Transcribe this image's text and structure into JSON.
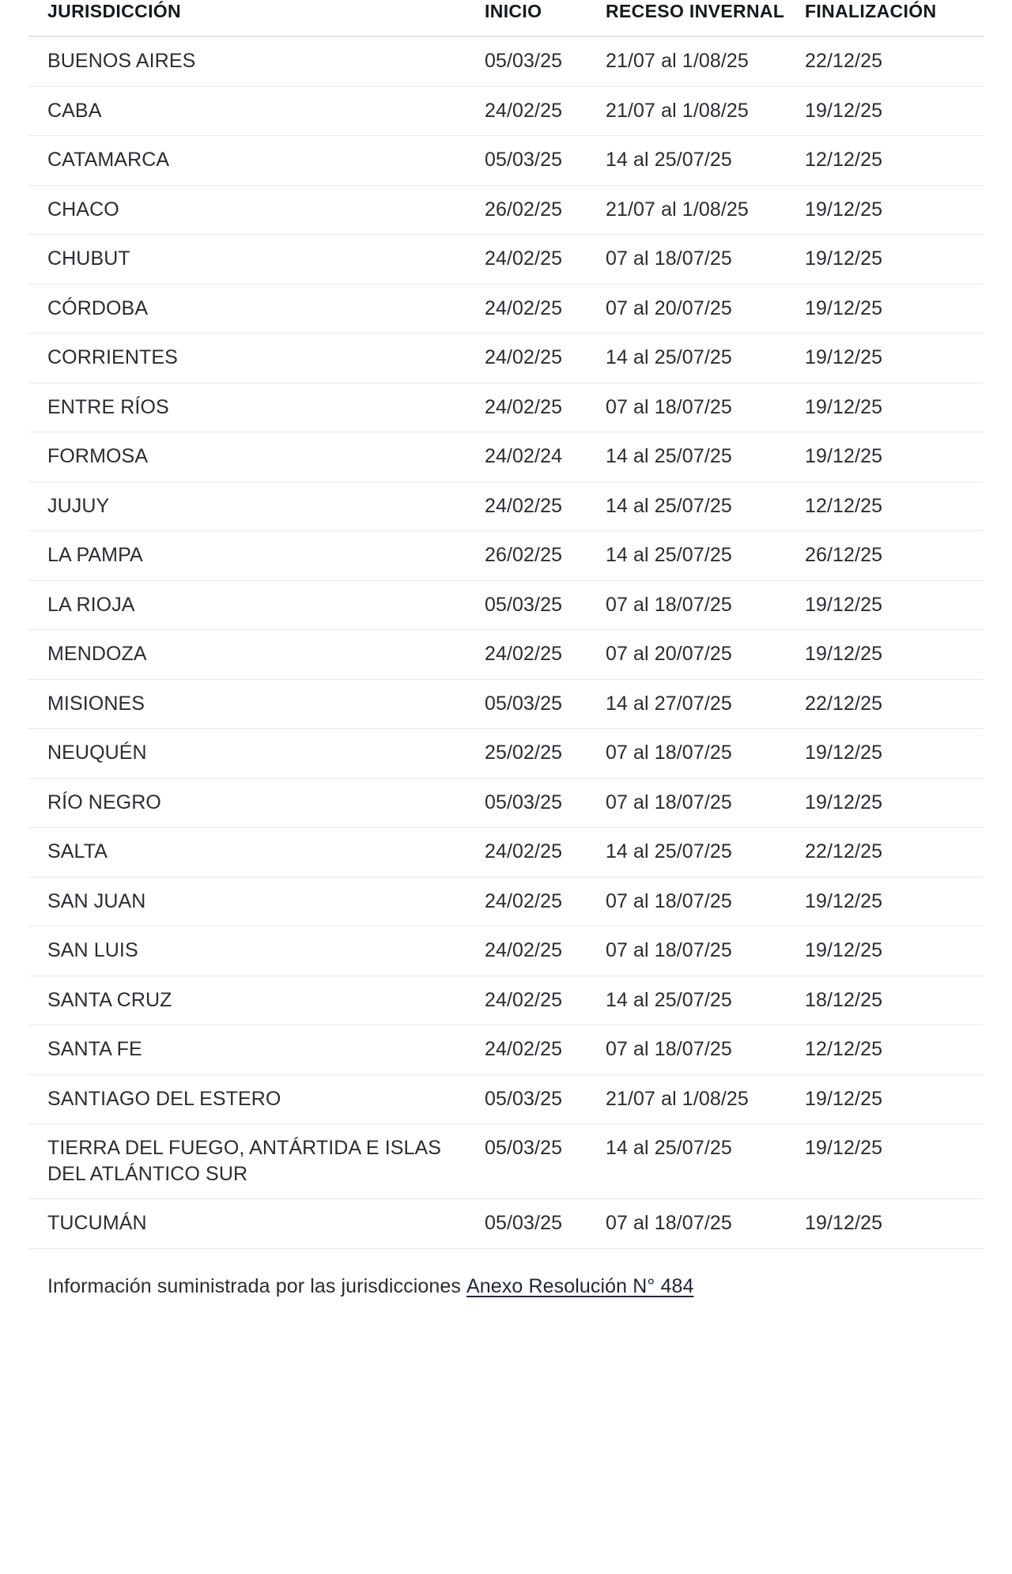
{
  "table": {
    "columns": [
      {
        "key": "jurisdiccion",
        "label": "JURISDICCIÓN"
      },
      {
        "key": "inicio",
        "label": "INICIO"
      },
      {
        "key": "receso_invernal",
        "label": "RECESO INVERNAL"
      },
      {
        "key": "finalizacion",
        "label": "FINALIZACIÓN"
      }
    ],
    "rows": [
      {
        "jurisdiccion": "BUENOS AIRES",
        "inicio": "05/03/25",
        "receso_invernal": "21/07 al 1/08/25",
        "finalizacion": "22/12/25"
      },
      {
        "jurisdiccion": "CABA",
        "inicio": "24/02/25",
        "receso_invernal": "21/07 al 1/08/25",
        "finalizacion": "19/12/25"
      },
      {
        "jurisdiccion": "CATAMARCA",
        "inicio": "05/03/25",
        "receso_invernal": "14 al 25/07/25",
        "finalizacion": "12/12/25"
      },
      {
        "jurisdiccion": "CHACO",
        "inicio": "26/02/25",
        "receso_invernal": "21/07 al 1/08/25",
        "finalizacion": "19/12/25"
      },
      {
        "jurisdiccion": "CHUBUT",
        "inicio": "24/02/25",
        "receso_invernal": "07 al 18/07/25",
        "finalizacion": "19/12/25"
      },
      {
        "jurisdiccion": "CÓRDOBA",
        "inicio": "24/02/25",
        "receso_invernal": "07 al 20/07/25",
        "finalizacion": "19/12/25"
      },
      {
        "jurisdiccion": "CORRIENTES",
        "inicio": "24/02/25",
        "receso_invernal": "14 al 25/07/25",
        "finalizacion": "19/12/25"
      },
      {
        "jurisdiccion": "ENTRE RÍOS",
        "inicio": "24/02/25",
        "receso_invernal": "07 al 18/07/25",
        "finalizacion": "19/12/25"
      },
      {
        "jurisdiccion": "FORMOSA",
        "inicio": "24/02/24",
        "receso_invernal": "14 al 25/07/25",
        "finalizacion": "19/12/25"
      },
      {
        "jurisdiccion": "JUJUY",
        "inicio": "24/02/25",
        "receso_invernal": "14 al 25/07/25",
        "finalizacion": "12/12/25"
      },
      {
        "jurisdiccion": "LA PAMPA",
        "inicio": "26/02/25",
        "receso_invernal": "14 al 25/07/25",
        "finalizacion": "26/12/25"
      },
      {
        "jurisdiccion": "LA RIOJA",
        "inicio": "05/03/25",
        "receso_invernal": "07 al 18/07/25",
        "finalizacion": "19/12/25"
      },
      {
        "jurisdiccion": "MENDOZA",
        "inicio": "24/02/25",
        "receso_invernal": "07 al 20/07/25",
        "finalizacion": "19/12/25"
      },
      {
        "jurisdiccion": "MISIONES",
        "inicio": "05/03/25",
        "receso_invernal": "14 al 27/07/25",
        "finalizacion": "22/12/25"
      },
      {
        "jurisdiccion": "NEUQUÉN",
        "inicio": "25/02/25",
        "receso_invernal": "07 al 18/07/25",
        "finalizacion": "19/12/25"
      },
      {
        "jurisdiccion": "RÍO NEGRO",
        "inicio": "05/03/25",
        "receso_invernal": "07 al 18/07/25",
        "finalizacion": "19/12/25"
      },
      {
        "jurisdiccion": "SALTA",
        "inicio": "24/02/25",
        "receso_invernal": "14 al 25/07/25",
        "finalizacion": "22/12/25"
      },
      {
        "jurisdiccion": "SAN JUAN",
        "inicio": "24/02/25",
        "receso_invernal": "07 al 18/07/25",
        "finalizacion": "19/12/25"
      },
      {
        "jurisdiccion": "SAN LUIS",
        "inicio": "24/02/25",
        "receso_invernal": "07 al 18/07/25",
        "finalizacion": "19/12/25"
      },
      {
        "jurisdiccion": "SANTA CRUZ",
        "inicio": "24/02/25",
        "receso_invernal": "14 al 25/07/25",
        "finalizacion": "18/12/25"
      },
      {
        "jurisdiccion": "SANTA FE",
        "inicio": "24/02/25",
        "receso_invernal": "07 al 18/07/25",
        "finalizacion": "12/12/25"
      },
      {
        "jurisdiccion": "SANTIAGO DEL ESTERO",
        "inicio": "05/03/25",
        "receso_invernal": "21/07 al 1/08/25",
        "finalizacion": "19/12/25"
      },
      {
        "jurisdiccion": "TIERRA DEL FUEGO, ANTÁRTIDA E ISLAS DEL ATLÁNTICO SUR",
        "inicio": "05/03/25",
        "receso_invernal": "14 al 25/07/25",
        "finalizacion": "19/12/25"
      },
      {
        "jurisdiccion": "TUCUMÁN",
        "inicio": "05/03/25",
        "receso_invernal": "07 al 18/07/25",
        "finalizacion": "19/12/25"
      }
    ]
  },
  "footer": {
    "text": "Información suministrada por las jurisdicciones",
    "link_label": "Anexo Resolución N° 484"
  },
  "colors": {
    "header_text": "#16181c",
    "body_text": "#2c2c30",
    "link_text": "#23243a",
    "rule": "#eaeaec",
    "header_rule": "#e4e4e6",
    "background": "#ffffff"
  }
}
